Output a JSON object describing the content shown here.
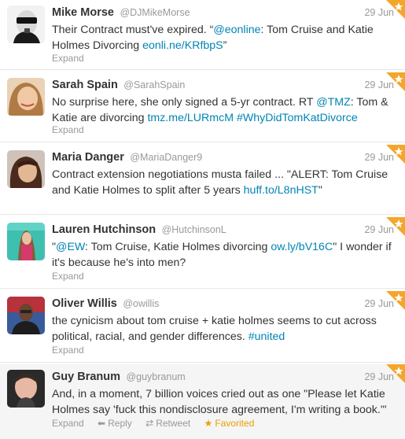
{
  "tweets": [
    {
      "fullname": "Mike Morse",
      "username": "@DJMikeMorse",
      "time": "29 Jun",
      "lines": [
        [
          {
            "t": "Their Contract must've expired. “"
          },
          {
            "t": "@eonline",
            "link": true
          },
          {
            "t": ": Tom Cruise and Katie"
          }
        ],
        [
          {
            "t": "Holmes Divorcing "
          },
          {
            "t": "eonli.ne/KRfbpS",
            "link": true
          },
          {
            "t": "”"
          }
        ]
      ],
      "expand": "Expand",
      "favorited": true
    },
    {
      "fullname": "Sarah Spain",
      "username": "@SarahSpain",
      "time": "29 Jun",
      "lines": [
        [
          {
            "t": "No surprise here, she only signed a 5-yr contract. RT "
          },
          {
            "t": "@TMZ",
            "link": true
          },
          {
            "t": ": Tom &"
          }
        ],
        [
          {
            "t": "Katie are divorcing "
          },
          {
            "t": "tmz.me/LURmcM",
            "link": true
          },
          {
            "t": " "
          },
          {
            "t": "#WhyDidTomKatDivorce",
            "link": true
          }
        ]
      ],
      "expand": "Expand",
      "favorited": true
    },
    {
      "fullname": "Maria Danger",
      "username": "@MariaDanger9",
      "time": "29 Jun",
      "lines": [
        [
          {
            "t": "Contract extension negotiations musta failed ... \"ALERT: Tom Cruise"
          }
        ],
        [
          {
            "t": "and Katie Holmes to split after 5 years "
          },
          {
            "t": "huff.to/L8nHST",
            "link": true
          },
          {
            "t": "\""
          }
        ]
      ],
      "expand": "Expand",
      "favorited": true
    },
    {
      "fullname": "Lauren Hutchinson",
      "username": "@HutchinsonL",
      "time": "29 Jun",
      "lines": [
        [
          {
            "t": "\""
          },
          {
            "t": "@EW",
            "link": true
          },
          {
            "t": ": Tom Cruise, Katie Holmes divorcing "
          },
          {
            "t": "ow.ly/bV16C",
            "link": true
          },
          {
            "t": "\" I wonder if"
          }
        ],
        [
          {
            "t": "it's because he's into men?"
          }
        ]
      ],
      "expand": "Expand",
      "favorited": true
    },
    {
      "fullname": "Oliver Willis",
      "username": "@owillis",
      "time": "29 Jun",
      "lines": [
        [
          {
            "t": "the cynicism about tom cruise + katie holmes seems to cut across"
          }
        ],
        [
          {
            "t": "political, racial, and gender differences. "
          },
          {
            "t": "#united",
            "link": true
          }
        ]
      ],
      "expand": "Expand",
      "favorited": true
    },
    {
      "fullname": "Guy Branum",
      "username": "@guybranum",
      "time": "29 Jun",
      "lines": [
        [
          {
            "t": "And, in a moment, 7 billion voices cried out as one \"Please let Katie"
          }
        ],
        [
          {
            "t": "Holmes say 'fuck this nondisclosure agreement, I'm writing a book.'\""
          }
        ]
      ],
      "expand": "Expand",
      "reply": "Reply",
      "retweet": "Retweet",
      "favorited_label": "Favorited",
      "favorited": true
    }
  ],
  "colors": {
    "link": "#0084b4",
    "muted": "#999999",
    "text": "#333333",
    "favorite": "#e6a100"
  },
  "icons": {
    "reply": "reply-arrow-icon",
    "retweet": "retweet-icon",
    "favorite": "star-icon",
    "corner": "favorite-corner-star-icon"
  }
}
